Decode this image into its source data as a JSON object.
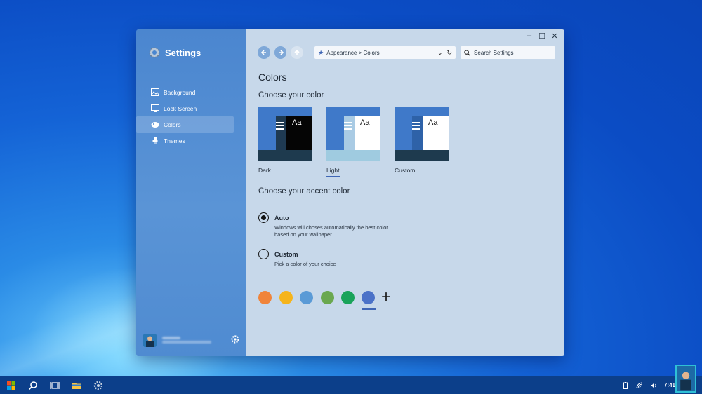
{
  "app": {
    "title": "Settings"
  },
  "sidebar": {
    "items": [
      {
        "label": "Background",
        "icon": "image-icon"
      },
      {
        "label": "Lock Screen",
        "icon": "monitor-icon"
      },
      {
        "label": "Colors",
        "icon": "palette-icon",
        "active": true
      },
      {
        "label": "Themes",
        "icon": "brush-icon"
      }
    ],
    "user_icon": "gear-icon"
  },
  "toolbar": {
    "breadcrumb": "Appearance > Colors",
    "search_placeholder": "Search Settings"
  },
  "window_controls": {
    "minimize": "–",
    "maximize": "☐",
    "close": "✕"
  },
  "page": {
    "title": "Colors",
    "choose_color": "Choose your color",
    "themes": [
      {
        "label": "Dark",
        "selected": false
      },
      {
        "label": "Light",
        "selected": true
      },
      {
        "label": "Custom",
        "selected": false
      }
    ],
    "theme_sample_text": "Aa",
    "choose_accent": "Choose your accent color",
    "options": [
      {
        "title": "Auto",
        "desc": "Windows will choses automatically the best color based on your wallpaper",
        "checked": true
      },
      {
        "title": "Custom",
        "desc": "Pick a color of your choice",
        "checked": false
      }
    ],
    "swatches": [
      "#f0843a",
      "#f5b41b",
      "#5a9ad6",
      "#6aa84f",
      "#19a35a",
      "#4b72c8"
    ],
    "selected_swatch": 5,
    "add_symbol": "+"
  },
  "taskbar": {
    "clock": "7:41"
  },
  "colors": {
    "accent": "#3f66b5",
    "sidebar": "#4b86cf",
    "content": "#c7d8ea",
    "taskbar": "#0c3f8a"
  }
}
